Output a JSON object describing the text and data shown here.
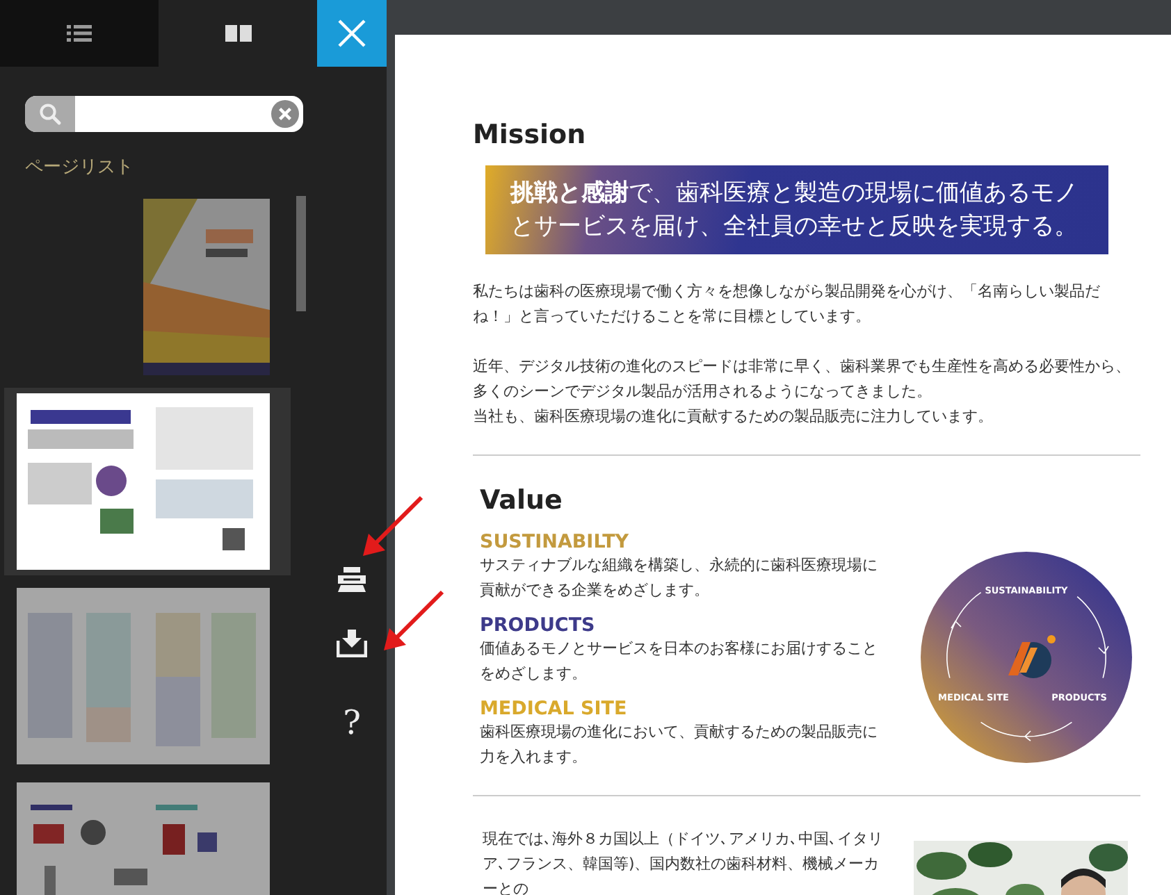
{
  "sidebar": {
    "tabs": [
      {
        "kind": "list",
        "selected": false
      },
      {
        "kind": "pages",
        "selected": true
      }
    ],
    "page_list": {
      "label": "ページリスト",
      "thumbnails": [
        {
          "selected": false
        },
        {
          "selected": true
        },
        {
          "selected": false
        },
        {
          "selected": false
        }
      ]
    }
  },
  "toolbar": {
    "tools": [
      {
        "kind": "print"
      },
      {
        "kind": "download"
      },
      {
        "kind": "help",
        "label": "?"
      }
    ]
  },
  "page": {
    "mission": {
      "heading": "Mission",
      "banner": "**挑戦と感謝**で、歯科医療と製造の現場に価値あるモノとサービスを届け、全社員の幸せと反映を実現する。",
      "paragraphs": [
        [
          "私たちは歯科の医療現場で働く方々を想像しながら製品開発を心がけ、「名南らしい製品だね！」と言っていただけることを常に目標としています。"
        ],
        [
          "近年、デジタル技術の進化のスピードは非常に早く、歯科業界でも生産性を高める必要性から、多くのシーンでデジタル製品が活用されるようになってきました。",
          "当社も、歯科医療現場の進化に貢献するための製品販売に注力しています。"
        ]
      ]
    },
    "value": {
      "heading": "Value",
      "items": [
        {
          "title": "SUSTINABILTY",
          "color": "#c39a3e",
          "text": "サスティナブルな組織を構築し、永続的に歯科医療現場に貢献ができる企業をめざします。"
        },
        {
          "title": "PRODUCTS",
          "color": "#3d3a8a",
          "text": "価値あるモノとサービスを日本のお客様にお届けすることをめざします。"
        },
        {
          "title": "MEDICAL SITE",
          "color": "#d9a92c",
          "text": "歯科医療現場の進化において、貢献するための製品販売に力を入れます。"
        }
      ],
      "cycle_labels": [
        "SUSTAINABILITY",
        "MEDICAL SITE",
        "PRODUCTS"
      ]
    },
    "company": {
      "text": "現在では､海外８カ国以上（ドイツ､アメリカ､中国､イタリア､フランス、韓国等)、国内数社の歯科材料、機械メーカーとの"
    }
  }
}
